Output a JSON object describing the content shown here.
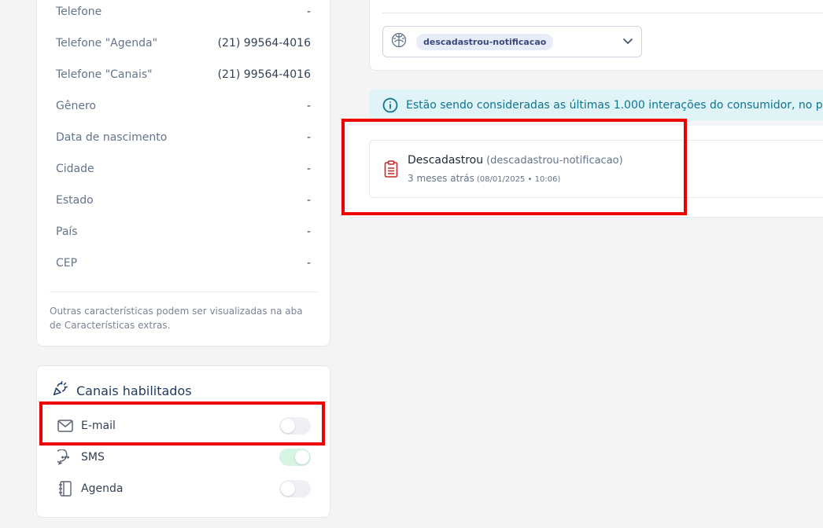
{
  "profile": {
    "fields": [
      {
        "label": "Telefone",
        "value": "-"
      },
      {
        "label": "Telefone \"Agenda\"",
        "value": "(21) 99564-4016"
      },
      {
        "label": "Telefone \"Canais\"",
        "value": "(21) 99564-4016"
      },
      {
        "label": "Gênero",
        "value": "-"
      },
      {
        "label": "Data de nascimento",
        "value": "-"
      },
      {
        "label": "Cidade",
        "value": "-"
      },
      {
        "label": "Estado",
        "value": "-"
      },
      {
        "label": "País",
        "value": "-"
      },
      {
        "label": "CEP",
        "value": "-"
      }
    ],
    "note": "Outras características podem ser visualizadas na aba de Características extras."
  },
  "channels": {
    "title": "Canais habilitados",
    "items": [
      {
        "label": "E-mail",
        "icon": "mail-icon",
        "enabled": false
      },
      {
        "label": "SMS",
        "icon": "chat-bubble-icon",
        "enabled": true
      },
      {
        "label": "Agenda",
        "icon": "notebook-icon",
        "enabled": false
      }
    ]
  },
  "filter": {
    "chip": "descadastrou-notificacao",
    "icon": "brain-icon"
  },
  "banner": {
    "text": "Estão sendo consideradas as últimas 1.000 interações do consumidor, no p"
  },
  "event": {
    "title": "Descadastrou",
    "code": "(descadastrou-notificacao)",
    "relative_time": "3 meses atrás",
    "date": "(08/01/2025 • 10:06)",
    "icon": "clipboard-list-icon"
  },
  "colors": {
    "accent_red": "#ee0000",
    "event_icon": "#c62828",
    "banner_bg": "#e0f4f8",
    "banner_text": "#0e7490",
    "toggle_on": "#d6f5e3"
  }
}
